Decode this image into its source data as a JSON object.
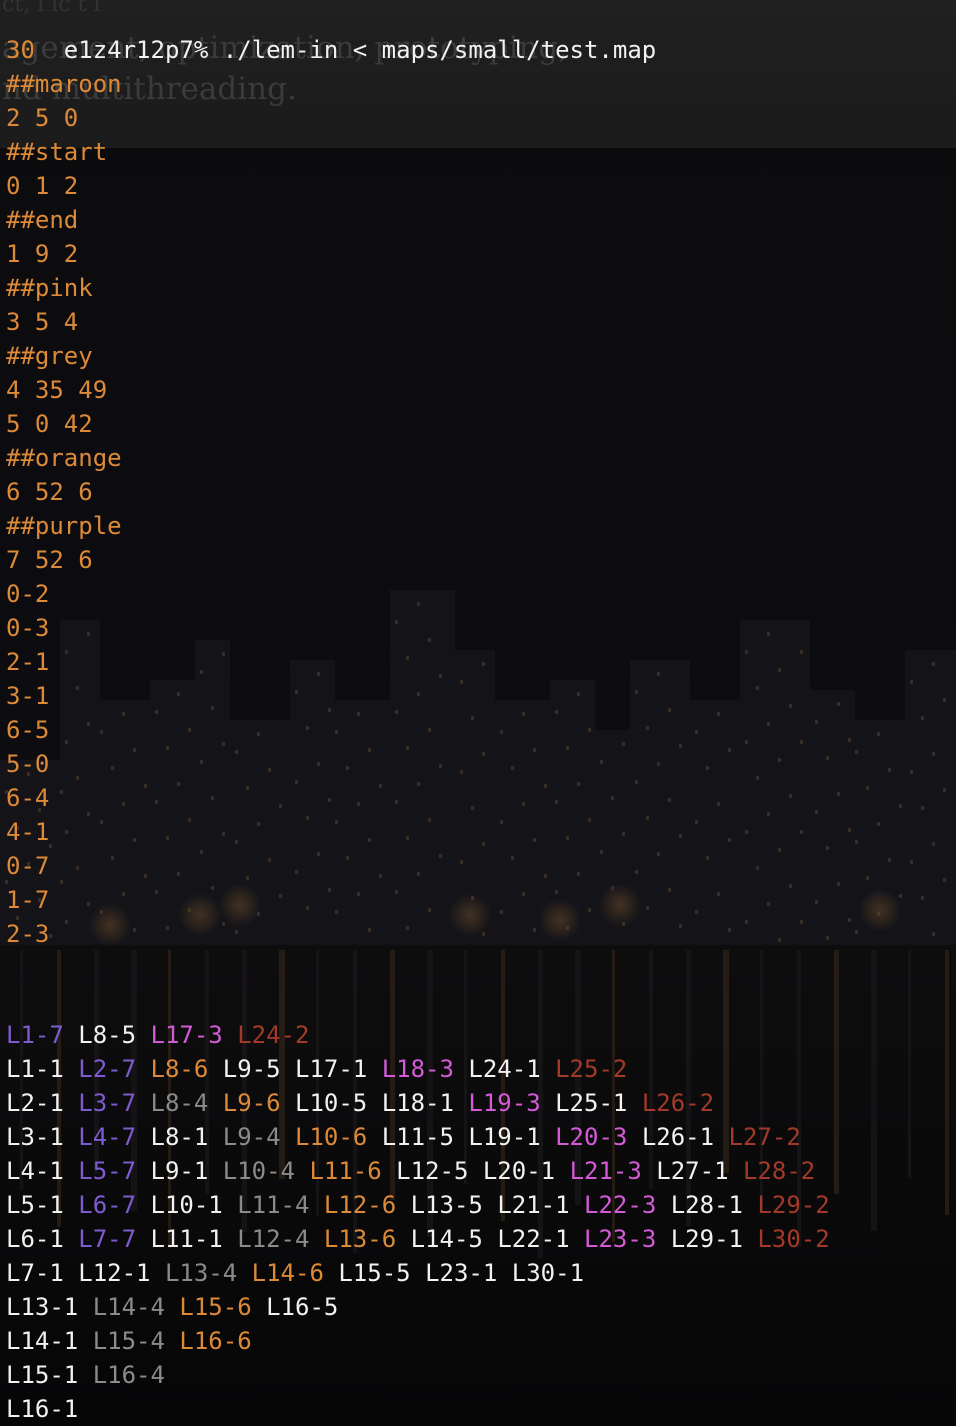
{
  "colors": {
    "white": "#f2f2f2",
    "orange": "#dc8a37",
    "violet": "#7f5bd2",
    "magenta": "#d45ad8",
    "darkred": "#a33a29",
    "grey": "#8b8b8b"
  },
  "background": {
    "ghost_lines": [
      "ct, l lc         t l",
      "agement, optimization, prototyping,",
      "nd multithreading."
    ]
  },
  "terminal": {
    "prompt_line": "e1z4r12p7% ./lem-in < maps/small/test.map",
    "map_lines": [
      "30",
      "##maroon",
      "2 5 0",
      "##start",
      "0 1 2",
      "##end",
      "1 9 2",
      "##pink",
      "3 5 4",
      "##grey",
      "4 35 49",
      "5 0 42",
      "##orange",
      "6 52 6",
      "##purple",
      "7 52 6",
      "0-2",
      "0-3",
      "2-1",
      "3-1",
      "6-5",
      "5-0",
      "6-4",
      "4-1",
      "0-7",
      "1-7",
      "2-3"
    ],
    "move_lines": [
      [
        [
          "L1-7",
          "violet"
        ],
        [
          "L8-5",
          "white"
        ],
        [
          "L17-3",
          "magenta"
        ],
        [
          "L24-2",
          "darkred"
        ]
      ],
      [
        [
          "L1-1",
          "white"
        ],
        [
          "L2-7",
          "violet"
        ],
        [
          "L8-6",
          "orange"
        ],
        [
          "L9-5",
          "white"
        ],
        [
          "L17-1",
          "white"
        ],
        [
          "L18-3",
          "magenta"
        ],
        [
          "L24-1",
          "white"
        ],
        [
          "L25-2",
          "darkred"
        ]
      ],
      [
        [
          "L2-1",
          "white"
        ],
        [
          "L3-7",
          "violet"
        ],
        [
          "L8-4",
          "grey"
        ],
        [
          "L9-6",
          "orange"
        ],
        [
          "L10-5",
          "white"
        ],
        [
          "L18-1",
          "white"
        ],
        [
          "L19-3",
          "magenta"
        ],
        [
          "L25-1",
          "white"
        ],
        [
          "L26-2",
          "darkred"
        ]
      ],
      [
        [
          "L3-1",
          "white"
        ],
        [
          "L4-7",
          "violet"
        ],
        [
          "L8-1",
          "white"
        ],
        [
          "L9-4",
          "grey"
        ],
        [
          "L10-6",
          "orange"
        ],
        [
          "L11-5",
          "white"
        ],
        [
          "L19-1",
          "white"
        ],
        [
          "L20-3",
          "magenta"
        ],
        [
          "L26-1",
          "white"
        ],
        [
          "L27-2",
          "darkred"
        ]
      ],
      [
        [
          "L4-1",
          "white"
        ],
        [
          "L5-7",
          "violet"
        ],
        [
          "L9-1",
          "white"
        ],
        [
          "L10-4",
          "grey"
        ],
        [
          "L11-6",
          "orange"
        ],
        [
          "L12-5",
          "white"
        ],
        [
          "L20-1",
          "white"
        ],
        [
          "L21-3",
          "magenta"
        ],
        [
          "L27-1",
          "white"
        ],
        [
          "L28-2",
          "darkred"
        ]
      ],
      [
        [
          "L5-1",
          "white"
        ],
        [
          "L6-7",
          "violet"
        ],
        [
          "L10-1",
          "white"
        ],
        [
          "L11-4",
          "grey"
        ],
        [
          "L12-6",
          "orange"
        ],
        [
          "L13-5",
          "white"
        ],
        [
          "L21-1",
          "white"
        ],
        [
          "L22-3",
          "magenta"
        ],
        [
          "L28-1",
          "white"
        ],
        [
          "L29-2",
          "darkred"
        ]
      ],
      [
        [
          "L6-1",
          "white"
        ],
        [
          "L7-7",
          "violet"
        ],
        [
          "L11-1",
          "white"
        ],
        [
          "L12-4",
          "grey"
        ],
        [
          "L13-6",
          "orange"
        ],
        [
          "L14-5",
          "white"
        ],
        [
          "L22-1",
          "white"
        ],
        [
          "L23-3",
          "magenta"
        ],
        [
          "L29-1",
          "white"
        ],
        [
          "L30-2",
          "darkred"
        ]
      ],
      [
        [
          "L7-1",
          "white"
        ],
        [
          "L12-1",
          "white"
        ],
        [
          "L13-4",
          "grey"
        ],
        [
          "L14-6",
          "orange"
        ],
        [
          "L15-5",
          "white"
        ],
        [
          "L23-1",
          "white"
        ],
        [
          "L30-1",
          "white"
        ]
      ],
      [
        [
          "L13-1",
          "white"
        ],
        [
          "L14-4",
          "grey"
        ],
        [
          "L15-6",
          "orange"
        ],
        [
          "L16-5",
          "white"
        ]
      ],
      [
        [
          "L14-1",
          "white"
        ],
        [
          "L15-4",
          "grey"
        ],
        [
          "L16-6",
          "orange"
        ]
      ],
      [
        [
          "L15-1",
          "white"
        ],
        [
          "L16-4",
          "grey"
        ]
      ],
      [
        [
          "L16-1",
          "white"
        ]
      ]
    ]
  }
}
